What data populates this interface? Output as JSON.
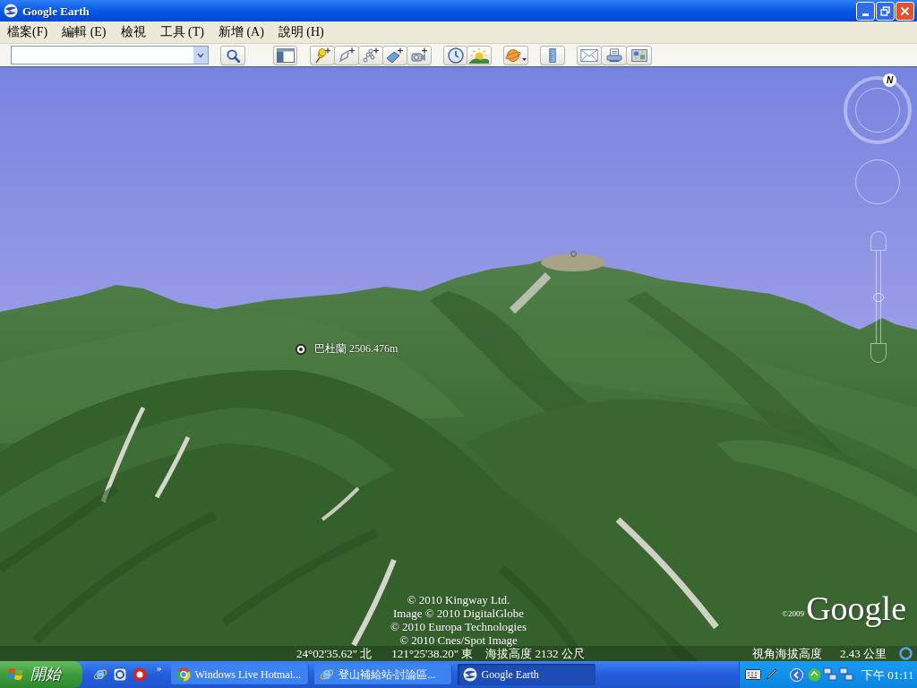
{
  "window": {
    "title": "Google Earth"
  },
  "menu_bar": [
    "檔案(F)",
    "編輯 (E)",
    "檢視",
    "工具 (T)",
    "新增 (A)",
    "說明 (H)"
  ],
  "view": {
    "placemark": {
      "label": "巴杜蘭 2506.476m"
    },
    "navigation": {
      "north": "N",
      "zoom": {
        "level": 0.5
      }
    },
    "attribution": [
      "© 2010 Kingway Ltd.",
      "Image © 2010 DigitalGlobe",
      "© 2010 Europa Technologies",
      "© 2010 Cnes/Spot Image"
    ],
    "logo": {
      "year": "©2009",
      "name": "Google"
    },
    "status_bar": {
      "latitude": "24°02'35.62\" 北",
      "longitude": "121°25'38.20\" 東",
      "elevation": "海拔高度 2132 公尺",
      "eye_altitude_label": "視角海拔高度",
      "eye_altitude": "2.43 公里"
    }
  },
  "taskbar": {
    "start": "開始",
    "more": "»",
    "tasks": [
      {
        "label": "Windows Live Hotmai...",
        "selected": false
      },
      {
        "label": "登山補給站-討論區...",
        "selected": false
      },
      {
        "label": "Google Earth",
        "selected": true
      }
    ],
    "clock": "下午 01:11"
  }
}
